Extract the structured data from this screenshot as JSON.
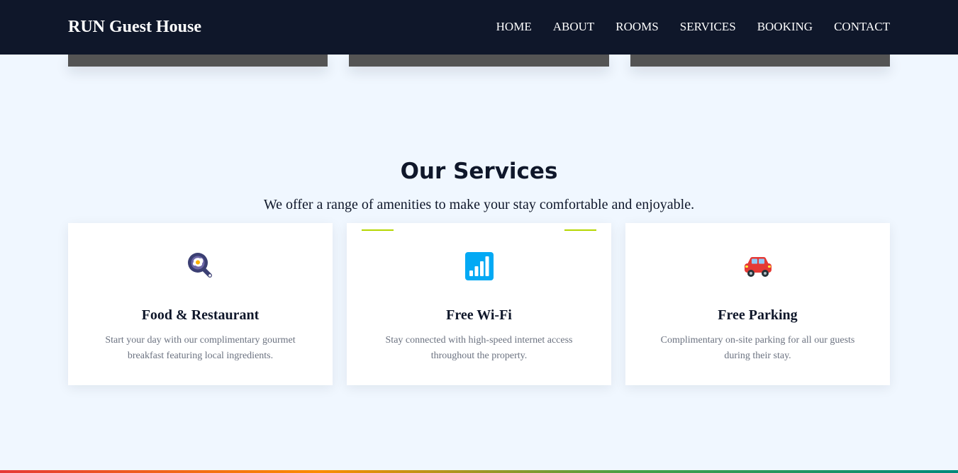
{
  "brand": "RUN Guest House",
  "nav": [
    {
      "label": "HOME"
    },
    {
      "label": "ABOUT"
    },
    {
      "label": "ROOMS"
    },
    {
      "label": "SERVICES"
    },
    {
      "label": "BOOKING"
    },
    {
      "label": "CONTACT"
    }
  ],
  "services": {
    "title": "Our Services",
    "subtitle": "We offer a range of amenities to make your stay comfortable and enjoyable.",
    "cards": [
      {
        "icon": "frying-pan-egg-icon",
        "title": "Food & Restaurant",
        "text": "Start your day with our complimentary gourmet breakfast featuring local ingredients."
      },
      {
        "icon": "signal-bars-icon",
        "title": "Free Wi-Fi",
        "text": "Stay connected with high-speed internet access throughout the property."
      },
      {
        "icon": "car-icon",
        "title": "Free Parking",
        "text": "Complimentary on-site parking for all our guests during their stay."
      }
    ]
  },
  "colors": {
    "navbar": "#0f172a",
    "page_background": "#f0f7ff",
    "accent": "#b5d600",
    "wifi_icon": "#03a9f4",
    "car_icon": "#e53935"
  }
}
